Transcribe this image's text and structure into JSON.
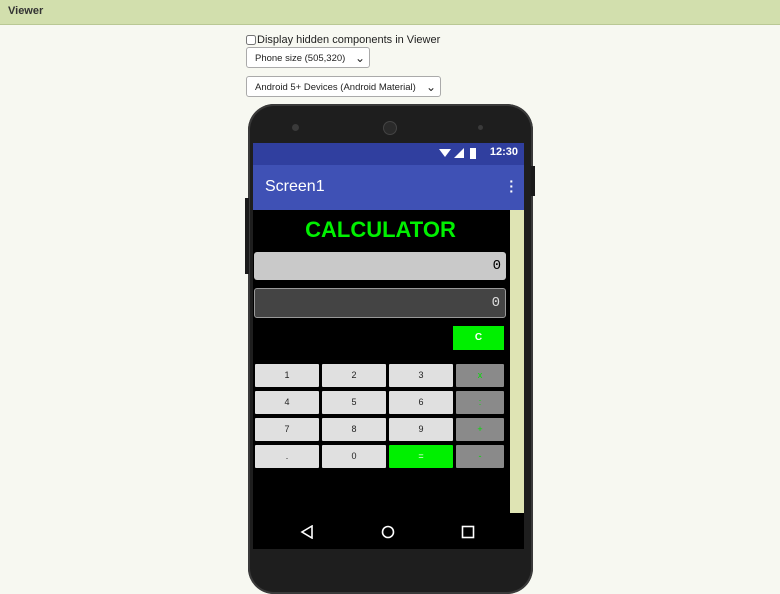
{
  "header": {
    "title": "Viewer"
  },
  "controls": {
    "hidden_label": "Display hidden components in Viewer",
    "size_select": "Phone size (505,320)",
    "theme_select": "Android 5+ Devices (Android Material)"
  },
  "phone": {
    "status_time": "12:30",
    "app_title": "Screen1",
    "calc_title": "CALCULATOR",
    "display1_value": "0",
    "display2_value": "0",
    "clear_label": "C",
    "keys": [
      [
        "1",
        "2",
        "3",
        "x"
      ],
      [
        "4",
        "5",
        "6",
        ":"
      ],
      [
        "7",
        "8",
        "9",
        "+"
      ],
      [
        ".",
        "0",
        "=",
        "-"
      ]
    ]
  },
  "colors": {
    "header_bg": "#d2dfad",
    "status_bar": "#303f9f",
    "app_bar": "#3f51b5",
    "accent_green": "#00f000"
  }
}
